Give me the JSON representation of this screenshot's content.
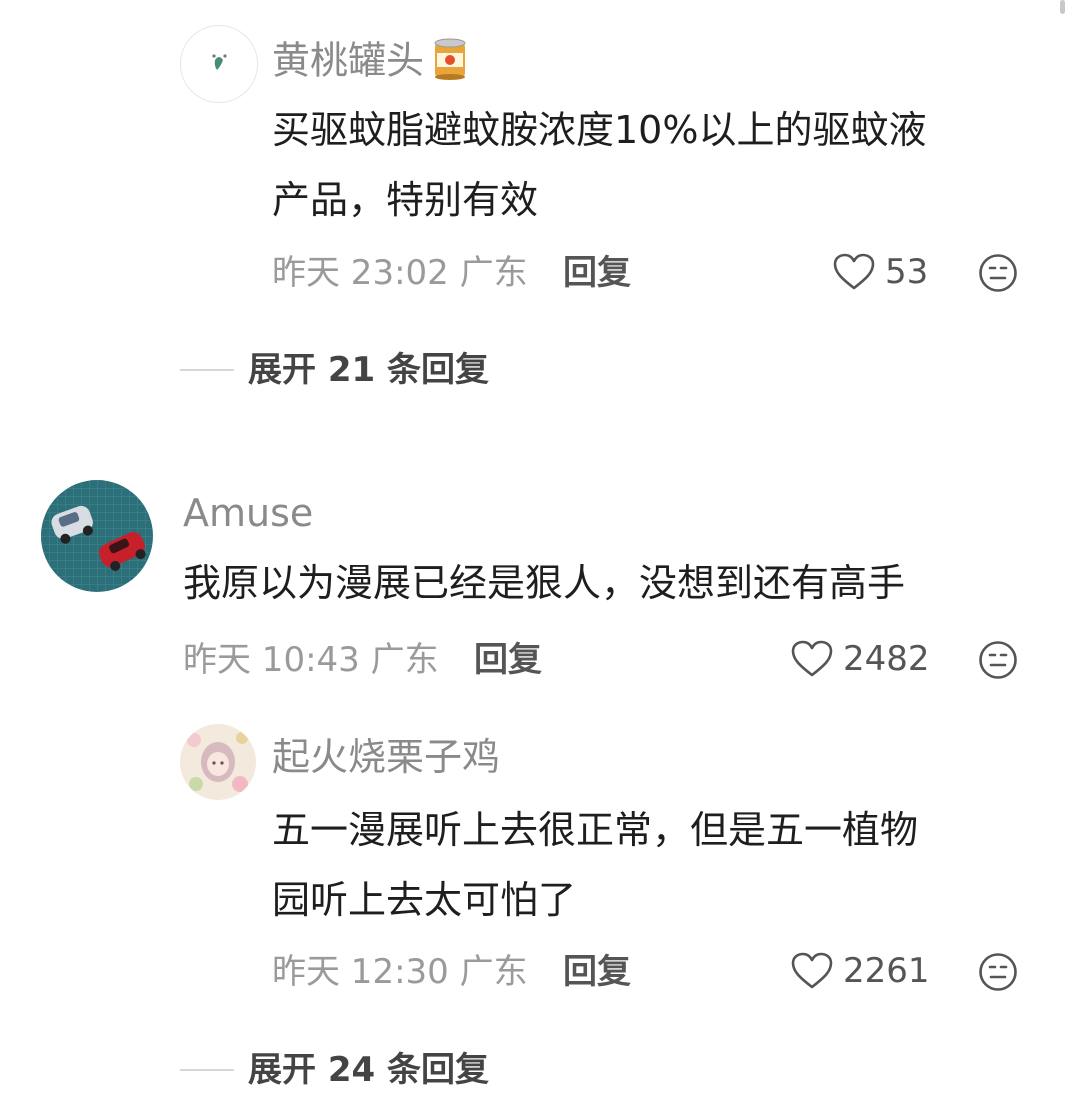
{
  "comments": [
    {
      "username": "黄桃罐头",
      "text_lines": [
        "买驱蚊脂避蚊胺浓度10%以上的驱蚊液",
        "产品，特别有效"
      ],
      "time": "昨天 23:02",
      "location": "广东",
      "reply_label": "回复",
      "likes": "53",
      "expand_label": "展开 21 条回复"
    },
    {
      "username": "Amuse",
      "text_lines": [
        "我原以为漫展已经是狠人，没想到还有高手"
      ],
      "time": "昨天 10:43",
      "location": "广东",
      "reply_label": "回复",
      "likes": "2482"
    },
    {
      "username": "起火烧栗子鸡",
      "text_lines": [
        "五一漫展听上去很正常，但是五一植物",
        "园听上去太可怕了"
      ],
      "time": "昨天 12:30",
      "location": "广东",
      "reply_label": "回复",
      "likes": "2261",
      "expand_label": "展开 24 条回复"
    }
  ],
  "colors": {
    "username": "#8a8a8a",
    "text": "#1e1e1e",
    "meta": "#9a9a9a",
    "divider": "#d6d6d6"
  },
  "icons": {
    "like": "heart-outline-icon",
    "dislike": "neutral-face-icon",
    "username_emoji": "canned-food-emoji-icon"
  }
}
